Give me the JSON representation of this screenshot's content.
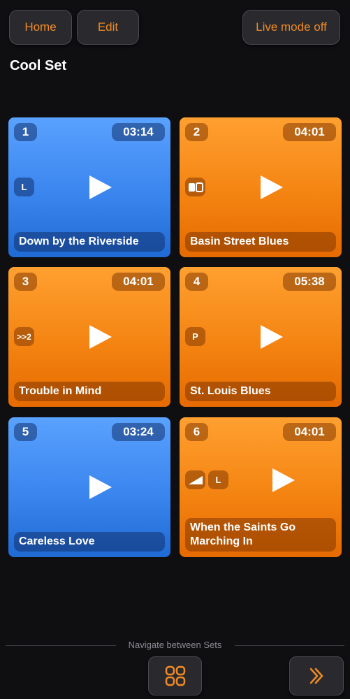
{
  "header": {
    "home_label": "Home",
    "edit_label": "Edit",
    "live_label": "Live mode off"
  },
  "set_title": "Cool Set",
  "tiles": [
    {
      "number": "1",
      "duration": "03:14",
      "title": "Down by the Riverside",
      "color": "blue",
      "badges": [
        "L"
      ]
    },
    {
      "number": "2",
      "duration": "04:01",
      "title": "Basin Street Blues",
      "color": "orange",
      "badges": [
        "toggle-icon"
      ]
    },
    {
      "number": "3",
      "duration": "04:01",
      "title": "Trouble in Mind",
      "color": "orange",
      "badges": [
        ">>2"
      ]
    },
    {
      "number": "4",
      "duration": "05:38",
      "title": "St. Louis Blues",
      "color": "orange",
      "badges": [
        "P"
      ]
    },
    {
      "number": "5",
      "duration": "03:24",
      "title": "Careless Love",
      "color": "blue",
      "badges": []
    },
    {
      "number": "6",
      "duration": "04:01",
      "title": "When the Saints Go Marching In",
      "color": "orange",
      "badges": [
        "ramp-icon",
        "L"
      ]
    }
  ],
  "footer": {
    "label": "Navigate between Sets"
  },
  "colors": {
    "accent": "#f08a24",
    "blue_tile": "#3a85ee",
    "orange_tile": "#f48412",
    "background": "#0f0f12"
  }
}
